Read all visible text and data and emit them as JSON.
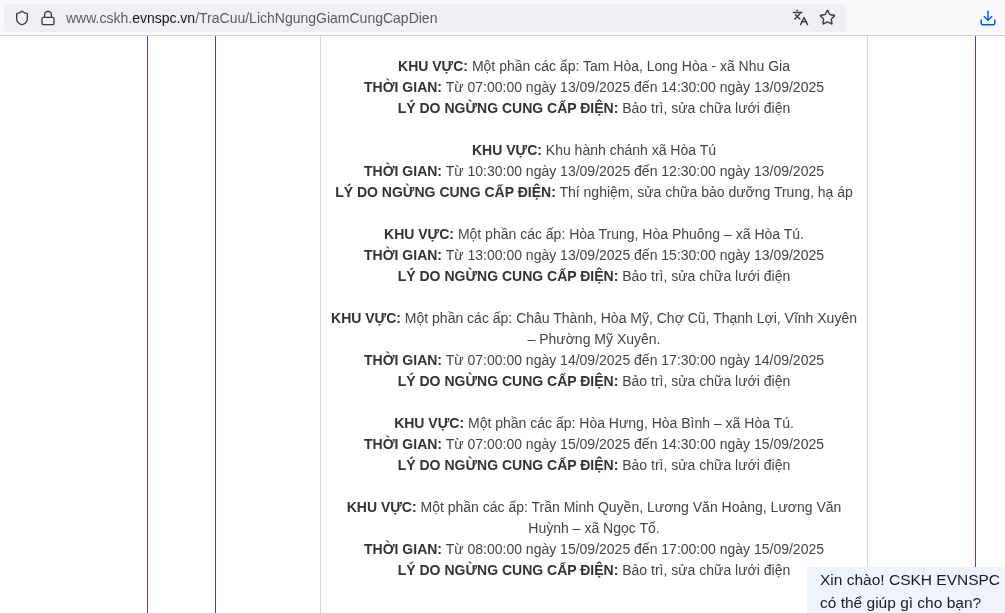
{
  "browser": {
    "url": {
      "prefix": "www.cskh.",
      "domain": "evnspc.vn",
      "path": "/TraCuu/LichNgungGiamCungCapDien"
    }
  },
  "outages": [
    {
      "fields": [
        {
          "label": "KHU VỰC:",
          "value": "Một phần các ấp: Tam Hòa, Long Hòa - xã Nhu Gia"
        },
        {
          "label": "THỜI GIAN:",
          "value": "Từ 07:00:00 ngày 13/09/2025 đến 14:30:00 ngày 13/09/2025"
        },
        {
          "label": "LÝ DO NGỪNG CUNG CẤP ĐIỆN:",
          "value": "Bảo trì, sửa chữa lưới điện"
        }
      ]
    },
    {
      "fields": [
        {
          "label": "KHU VỰC:",
          "value": "Khu hành chánh xã Hòa Tú"
        },
        {
          "label": "THỜI GIAN:",
          "value": "Từ 10:30:00 ngày 13/09/2025 đến 12:30:00 ngày 13/09/2025"
        },
        {
          "label": "LÝ DO NGỪNG CUNG CẤP ĐIỆN:",
          "value": "Thí nghiệm, sửa chữa bảo dưỡng Trung, hạ áp"
        }
      ]
    },
    {
      "fields": [
        {
          "label": "KHU VỰC:",
          "value": "Một phần các ấp: Hòa Trung, Hòa Phuông – xã Hòa Tú."
        },
        {
          "label": "THỜI GIAN:",
          "value": "Từ 13:00:00 ngày 13/09/2025 đến 15:30:00 ngày 13/09/2025"
        },
        {
          "label": "LÝ DO NGỪNG CUNG CẤP ĐIỆN:",
          "value": "Bảo trì, sửa chữa lưới điện"
        }
      ]
    },
    {
      "fields": [
        {
          "label": "KHU VỰC:",
          "value": "Một phần các ấp: Châu Thành, Hòa Mỹ, Chợ Cũ, Thạnh Lợi, Vĩnh Xuyên – Phường Mỹ Xuyên."
        },
        {
          "label": "THỜI GIAN:",
          "value": "Từ 07:00:00 ngày 14/09/2025 đến 17:30:00 ngày 14/09/2025"
        },
        {
          "label": "LÝ DO NGỪNG CUNG CẤP ĐIỆN:",
          "value": "Bảo trì, sửa chữa lưới điện"
        }
      ]
    },
    {
      "fields": [
        {
          "label": "KHU VỰC:",
          "value": "Một phần các ấp: Hòa Hưng, Hòa Bình – xã Hòa Tú."
        },
        {
          "label": "THỜI GIAN:",
          "value": "Từ 07:00:00 ngày 15/09/2025 đến 14:30:00 ngày 15/09/2025"
        },
        {
          "label": "LÝ DO NGỪNG CUNG CẤP ĐIỆN:",
          "value": "Bảo trì, sửa chữa lưới điện"
        }
      ]
    },
    {
      "fields": [
        {
          "label": "KHU VỰC:",
          "value": "Một phần các ấp: Trần Minh Quyền, Lương Văn Hoàng, Lương Văn Huỳnh – xã Ngọc Tố."
        },
        {
          "label": "THỜI GIAN:",
          "value": "Từ 08:00:00 ngày 15/09/2025 đến 17:00:00 ngày 15/09/2025"
        },
        {
          "label": "LÝ DO NGỪNG CUNG CẤP ĐIỆN:",
          "value": "Bảo trì, sửa chữa lưới điện"
        }
      ]
    }
  ],
  "chat": {
    "greeting": "Xin chào! CSKH EVNSPC có thể giúp gì cho bạn?"
  }
}
